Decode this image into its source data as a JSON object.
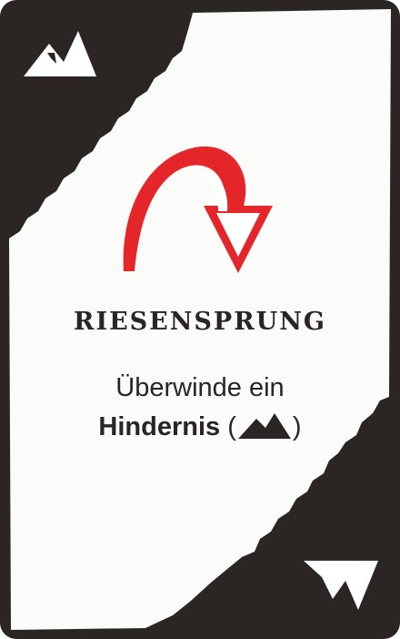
{
  "card": {
    "title": "RIESENSPRUNG",
    "text_line1": "Überwinde ein",
    "text_line2_word": "Hindernis",
    "paren_open": "(",
    "paren_close": ")",
    "icons": {
      "corner_top": "mountain-icon",
      "corner_bottom": "mountain-icon-inverted",
      "center": "jump-arrow-icon",
      "inline": "mountain-icon"
    },
    "colors": {
      "frame": "#2b2624",
      "paper": "#fbfbf9",
      "arrow_red": "#e4262b",
      "text": "#2a2422"
    }
  }
}
